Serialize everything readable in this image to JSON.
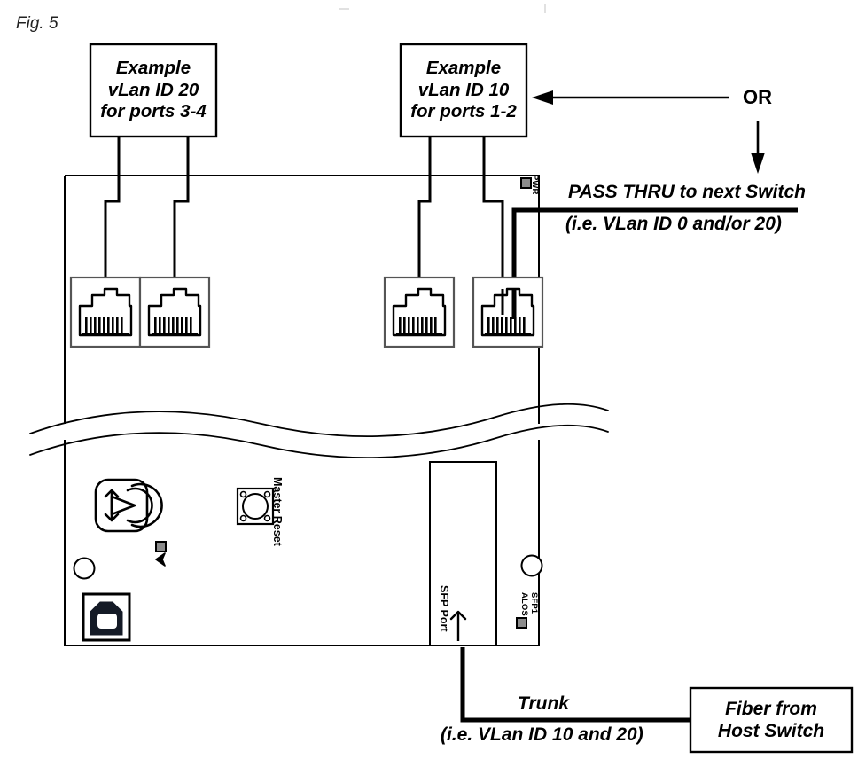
{
  "figure": {
    "label": "Fig. 5"
  },
  "callouts": {
    "left_box": {
      "line1": "Example",
      "line2": "vLan ID 20",
      "line3": "for ports 3-4"
    },
    "right_box": {
      "line1": "Example",
      "line2": "vLan ID 10",
      "line3": "for ports 1-2"
    },
    "or_label": "OR",
    "passthru": {
      "line1": "PASS THRU to next Switch",
      "line2": "(i.e. VLan ID 0 and/or 20)"
    },
    "trunk": {
      "line1": "Trunk",
      "line2": "(i.e. VLan ID 10 and 20)"
    },
    "fiber_box": {
      "line1": "Fiber from",
      "line2": "Host Switch"
    }
  },
  "device": {
    "indicators": {
      "pwr": "PWR",
      "sfp1": "SFP1",
      "alos": "ALOS"
    },
    "controls": {
      "master_reset": "Master Reset",
      "sfp_port": "SFP Port"
    },
    "ports": [
      {
        "name": "rj45-port-4"
      },
      {
        "name": "rj45-port-3"
      },
      {
        "name": "rj45-port-2"
      },
      {
        "name": "rj45-port-1"
      }
    ]
  },
  "colors": {
    "line": "#000000",
    "fill": "#ffffff",
    "usb_dark": "#141a26",
    "led_gray": "#8c8c8c"
  }
}
